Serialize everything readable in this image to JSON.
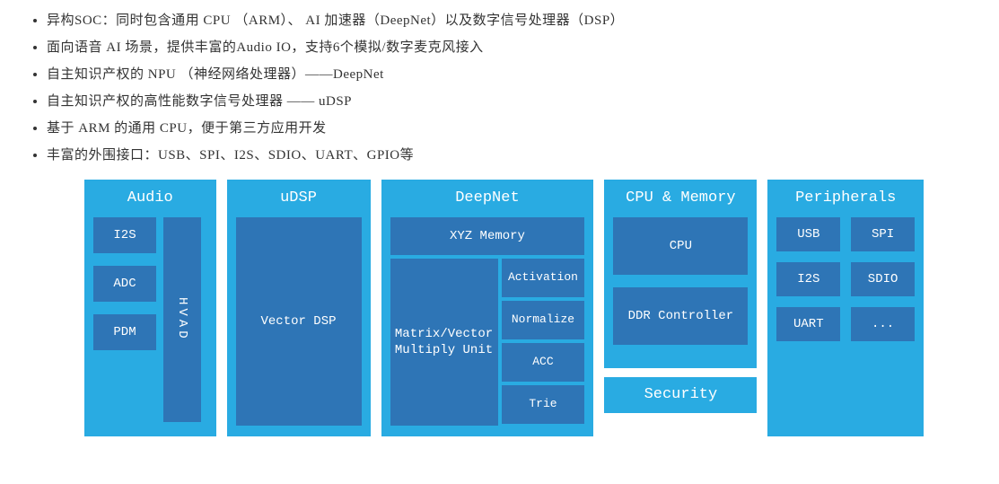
{
  "bullets": [
    "异构SOC：同时包含通用 CPU （ARM）、 AI 加速器（DeepNet）以及数字信号处理器（DSP）",
    "面向语音 AI 场景，提供丰富的Audio IO，支持6个模拟/数字麦克风接入",
    "自主知识产权的 NPU （神经网络处理器）——DeepNet",
    "自主知识产权的高性能数字信号处理器 —— uDSP",
    "基于 ARM 的通用 CPU，便于第三方应用开发",
    "丰富的外围接口：USB、SPI、I2S、SDIO、UART、GPIO等"
  ],
  "audio": {
    "title": "Audio",
    "i2s": "I2S",
    "adc": "ADC",
    "pdm": "PDM",
    "hvad": "HVAD"
  },
  "udsp": {
    "title": "uDSP",
    "vector": "Vector DSP"
  },
  "deepnet": {
    "title": "DeepNet",
    "xyz": "XYZ Memory",
    "mvm": "Matrix/Vector Multiply Unit",
    "act": "Activation",
    "norm": "Normalize",
    "acc": "ACC",
    "trie": "Trie"
  },
  "cpumem": {
    "title": "CPU & Memory",
    "cpu": "CPU",
    "ddr": "DDR Controller"
  },
  "security": {
    "title": "Security"
  },
  "peripherals": {
    "title": "Peripherals",
    "usb": "USB",
    "spi": "SPI",
    "i2s": "I2S",
    "sdio": "SDIO",
    "uart": "UART",
    "more": "..."
  }
}
